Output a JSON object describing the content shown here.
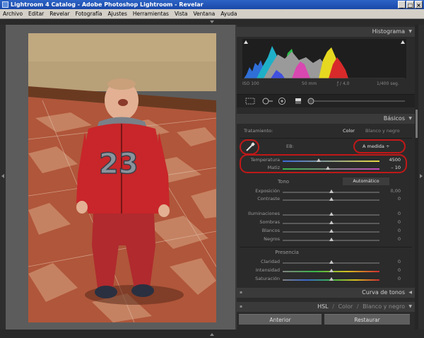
{
  "window": {
    "title": "Lightroom 4 Catalog - Adobe Photoshop Lightroom - Revelar",
    "controls": [
      "_",
      "□",
      "×"
    ]
  },
  "menu": [
    "Archivo",
    "Editar",
    "Revelar",
    "Fotografía",
    "Ajustes",
    "Herramientas",
    "Vista",
    "Ventana",
    "Ayuda"
  ],
  "histogram": {
    "title": "Histograma",
    "iso": "ISO 100",
    "focal": "50 mm",
    "aperture": "ƒ / 4,0",
    "shutter": "1/400 seg."
  },
  "basics": {
    "title": "Básicos",
    "treatment_label": "Tratamiento:",
    "treatment_color": "Color",
    "treatment_bw": "Blanco y negro",
    "wb_label": "EB:",
    "wb_value": "A medida ÷",
    "temperature_label": "Temperatura",
    "temperature_value": "4500",
    "temperature_level": 0.37,
    "tint_label": "Matiz",
    "tint_value": "– 10",
    "tint_level": 0.47,
    "tone_label": "Tono",
    "auto_label": "Automático",
    "exposure_label": "Exposición",
    "exposure_value": "0,00",
    "contrast_label": "Contraste",
    "contrast_value": "0",
    "highlights_label": "Iluminaciones",
    "highlights_value": "0",
    "shadows_label": "Sombras",
    "shadows_value": "0",
    "whites_label": "Blancos",
    "whites_value": "0",
    "blacks_label": "Negros",
    "blacks_value": "0",
    "presence_label": "Presencia",
    "clarity_label": "Claridad",
    "clarity_value": "0",
    "vibrance_label": "Intensidad",
    "vibrance_value": "0",
    "saturation_label": "Saturación",
    "saturation_value": "0"
  },
  "panels": {
    "tone_curve": "Curva de tonos",
    "hsl": "HSL",
    "sep1": "/",
    "color": "Color",
    "sep2": "/",
    "bw": "Blanco y negro"
  },
  "buttons": {
    "previous": "Anterior",
    "reset": "Restaurar"
  },
  "colors": {
    "accent_red": "#c01818",
    "panel_bg": "#2b2b2b"
  }
}
